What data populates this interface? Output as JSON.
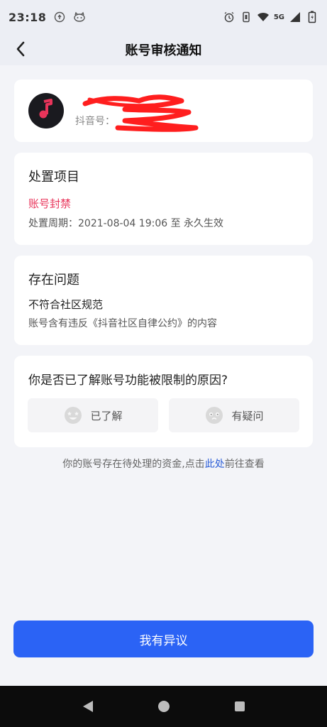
{
  "status_bar": {
    "time": "23:18",
    "network": "5G",
    "icons": [
      "upload-circle-icon",
      "cat-face-icon",
      "alarm-icon",
      "vibrate-icon",
      "wifi-icon",
      "signal-icon",
      "battery-icon"
    ]
  },
  "nav": {
    "title": "账号审核通知",
    "back_icon": "chevron-left-icon"
  },
  "profile": {
    "name": "",
    "subtitle": "抖音号：",
    "avatar_icon": "music-note-icon",
    "avatar_color": "#e8345a",
    "redaction_color": "#ff1e1e"
  },
  "action": {
    "title": "处置项目",
    "type": "账号封禁",
    "period": "处置周期：2021-08-04 19:06 至 永久生效"
  },
  "issue": {
    "title": "存在问题",
    "name": "不符合社区规范",
    "description": "账号含有违反《抖音社区自律公约》的内容"
  },
  "question": {
    "title": "你是否已了解账号功能被限制的原因?",
    "options": [
      {
        "label": "已了解",
        "icon": "smile-star-eyes-icon"
      },
      {
        "label": "有疑问",
        "icon": "confused-face-icon"
      }
    ]
  },
  "fund_notice": {
    "prefix": "你的账号存在待处理的资金,点击",
    "link": "此处",
    "suffix": "前往查看"
  },
  "appeal_button": "我有异议",
  "colors": {
    "accent": "#2b63f5",
    "danger": "#e8345a",
    "link": "#2a5cd6"
  },
  "android_nav": [
    "back-triangle-icon",
    "home-circle-icon",
    "recents-square-icon"
  ]
}
